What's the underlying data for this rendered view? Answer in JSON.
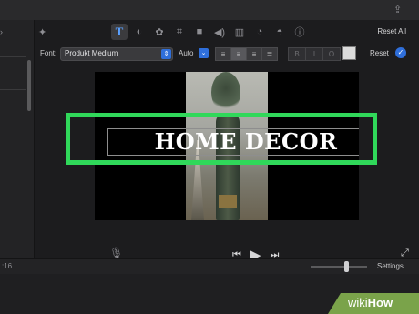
{
  "toolbar": {
    "reset_all": "Reset All",
    "tools": [
      {
        "icon": "title-T-icon",
        "glyph": "T",
        "active": true
      },
      {
        "icon": "color-balance-icon",
        "glyph": "◐"
      },
      {
        "icon": "color-palette-icon",
        "glyph": "✿"
      },
      {
        "icon": "crop-icon",
        "glyph": "⌗"
      },
      {
        "icon": "camera-icon",
        "glyph": "■"
      },
      {
        "icon": "volume-icon",
        "glyph": "◀)"
      },
      {
        "icon": "equalizer-icon",
        "glyph": "▥"
      },
      {
        "icon": "speed-icon",
        "glyph": "◔"
      },
      {
        "icon": "noise-reduction-icon",
        "glyph": "◓"
      },
      {
        "icon": "info-icon",
        "glyph": "ⓘ"
      }
    ]
  },
  "font_row": {
    "label": "Font:",
    "font_value": "Produkt Medium",
    "size_value": "Auto",
    "style_bold": "B",
    "style_italic": "I",
    "style_outline": "O",
    "reset": "Reset"
  },
  "viewer": {
    "title_text": "HOME DECOR"
  },
  "status": {
    "time": ":16",
    "settings": "Settings"
  },
  "watermark": {
    "wiki": "wiki",
    "how": "How"
  },
  "colors": {
    "highlight": "#30d85a",
    "accent": "#2f6fdb"
  }
}
